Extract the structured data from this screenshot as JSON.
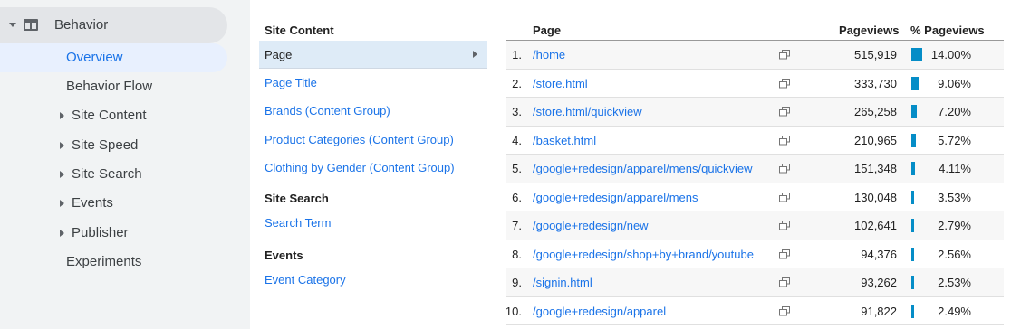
{
  "sidebar": {
    "behavior_label": "Behavior",
    "overview_label": "Overview",
    "items": [
      {
        "label": "Behavior Flow"
      },
      {
        "label": "Site Content"
      },
      {
        "label": "Site Speed"
      },
      {
        "label": "Site Search"
      },
      {
        "label": "Events"
      },
      {
        "label": "Publisher"
      },
      {
        "label": "Experiments"
      }
    ]
  },
  "middle": {
    "site_content_header": "Site Content",
    "site_content_items": [
      "Page",
      "Page Title",
      "Brands (Content Group)",
      "Product Categories (Content Group)",
      "Clothing by Gender (Content Group)"
    ],
    "site_search_header": "Site Search",
    "site_search_items": [
      "Search Term"
    ],
    "events_header": "Events",
    "events_items": [
      "Event Category"
    ]
  },
  "table": {
    "headers": {
      "page": "Page",
      "pageviews": "Pageviews",
      "pct_pageviews": "% Pageviews"
    },
    "rows": [
      {
        "idx": "1.",
        "page": "/home",
        "pageviews": "515,919",
        "pct": "14.00%",
        "share": 14.0
      },
      {
        "idx": "2.",
        "page": "/store.html",
        "pageviews": "333,730",
        "pct": "9.06%",
        "share": 9.06
      },
      {
        "idx": "3.",
        "page": "/store.html/quickview",
        "pageviews": "265,258",
        "pct": "7.20%",
        "share": 7.2
      },
      {
        "idx": "4.",
        "page": "/basket.html",
        "pageviews": "210,965",
        "pct": "5.72%",
        "share": 5.72
      },
      {
        "idx": "5.",
        "page": "/google+redesign/apparel/mens/quickview",
        "pageviews": "151,348",
        "pct": "4.11%",
        "share": 4.11
      },
      {
        "idx": "6.",
        "page": "/google+redesign/apparel/mens",
        "pageviews": "130,048",
        "pct": "3.53%",
        "share": 3.53
      },
      {
        "idx": "7.",
        "page": "/google+redesign/new",
        "pageviews": "102,641",
        "pct": "2.79%",
        "share": 2.79
      },
      {
        "idx": "8.",
        "page": "/google+redesign/shop+by+brand/youtube",
        "pageviews": "94,376",
        "pct": "2.56%",
        "share": 2.56
      },
      {
        "idx": "9.",
        "page": "/signin.html",
        "pageviews": "93,262",
        "pct": "2.53%",
        "share": 2.53
      },
      {
        "idx": "10.",
        "page": "/google+redesign/apparel",
        "pageviews": "91,822",
        "pct": "2.49%",
        "share": 2.49
      }
    ],
    "bar_color": "#058dc7",
    "link_color": "#1a73e8"
  }
}
